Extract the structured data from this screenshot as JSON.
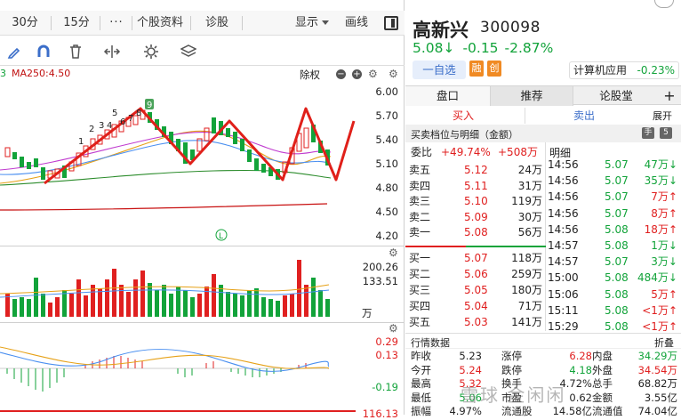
{
  "toolbar": {
    "tabs": [
      "30分",
      "15分",
      "个股资料",
      "诊股"
    ],
    "more": "···",
    "display": "显示",
    "draw": "画线"
  },
  "ma_line": {
    "index": "3",
    "ma250": "MA250:4.50",
    "adjust": "除权"
  },
  "axis": {
    "price": [
      "6.00",
      "5.70",
      "5.40",
      "5.10",
      "4.80",
      "4.50",
      "4.20"
    ],
    "volume": [
      "200.26",
      "133.51",
      "万"
    ],
    "macd": [
      "0.29",
      "0.13",
      "-0.19",
      "116.13"
    ]
  },
  "stock": {
    "name": "高新兴",
    "code": "300098",
    "price": "5.08↓",
    "change": "-0.15",
    "pct": "-2.87%"
  },
  "actions": {
    "watch": "一自选",
    "rong": "融",
    "chuang": "创"
  },
  "sector": {
    "name": "计算机应用",
    "pct": "-0.23%"
  },
  "tabs": [
    "盘口",
    "推荐",
    "论股堂",
    "+"
  ],
  "subtabs": {
    "buy": "买入",
    "sell": "卖出",
    "expand": "展开"
  },
  "section_title": "买卖档位与明细（金额）",
  "section_badges": [
    "手",
    "5"
  ],
  "weibi": {
    "label": "委比",
    "pct": "+49.74%",
    "amount": "+508万"
  },
  "detail_title": "明细",
  "asks": [
    {
      "label": "卖五",
      "price": "5.12",
      "vol": "24万"
    },
    {
      "label": "卖四",
      "price": "5.11",
      "vol": "31万"
    },
    {
      "label": "卖三",
      "price": "5.10",
      "vol": "119万"
    },
    {
      "label": "卖二",
      "price": "5.09",
      "vol": "30万"
    },
    {
      "label": "卖一",
      "price": "5.08",
      "vol": "56万"
    }
  ],
  "bids": [
    {
      "label": "买一",
      "price": "5.07",
      "vol": "118万"
    },
    {
      "label": "买二",
      "price": "5.06",
      "vol": "259万"
    },
    {
      "label": "买三",
      "price": "5.05",
      "vol": "180万"
    },
    {
      "label": "买四",
      "price": "5.04",
      "vol": "71万"
    },
    {
      "label": "买五",
      "price": "5.03",
      "vol": "141万"
    }
  ],
  "trades": [
    {
      "time": "14:56",
      "price": "5.07",
      "vol": "47万↓",
      "dir": "down"
    },
    {
      "time": "14:56",
      "price": "5.07",
      "vol": "35万↓",
      "dir": "down"
    },
    {
      "time": "14:56",
      "price": "5.07",
      "vol": "7万↑",
      "dir": "up"
    },
    {
      "time": "14:56",
      "price": "5.07",
      "vol": "8万↑",
      "dir": "up"
    },
    {
      "time": "14:56",
      "price": "5.08",
      "vol": "18万↑",
      "dir": "up"
    },
    {
      "time": "14:57",
      "price": "5.08",
      "vol": "1万↓",
      "dir": "down"
    },
    {
      "time": "14:57",
      "price": "5.07",
      "vol": "3万↓",
      "dir": "down"
    },
    {
      "time": "15:00",
      "price": "5.08",
      "vol": "484万↓",
      "dir": "down"
    },
    {
      "time": "15:06",
      "price": "5.08",
      "vol": "5万↑",
      "dir": "up"
    },
    {
      "time": "15:11",
      "price": "5.08",
      "vol": "<1万↑",
      "dir": "up"
    },
    {
      "time": "15:29",
      "price": "5.08",
      "vol": "<1万↑",
      "dir": "up"
    }
  ],
  "stats_title": "行情数据",
  "stats_fold": "折叠",
  "stats": [
    [
      {
        "k": "昨收",
        "v": "5.23",
        "c": "n"
      },
      {
        "k": "涨停",
        "v": "6.28",
        "c": "r"
      },
      {
        "k": "内盘",
        "v": "34.29万",
        "c": "g"
      }
    ],
    [
      {
        "k": "今开",
        "v": "5.24",
        "c": "r"
      },
      {
        "k": "跌停",
        "v": "4.18",
        "c": "g"
      },
      {
        "k": "外盘",
        "v": "34.54万",
        "c": "r"
      }
    ],
    [
      {
        "k": "最高",
        "v": "5.32",
        "c": "r"
      },
      {
        "k": "换手",
        "v": "4.72%",
        "c": "n"
      },
      {
        "k": "总手",
        "v": "68.82万",
        "c": "n"
      }
    ],
    [
      {
        "k": "最低",
        "v": "5.06",
        "c": "g"
      },
      {
        "k": "市盈",
        "v": "0.62",
        "c": "n"
      },
      {
        "k": "金额",
        "v": "3.55亿",
        "c": "n"
      }
    ],
    [
      {
        "k": "振幅",
        "v": "4.97%",
        "c": "n"
      },
      {
        "k": "流通股",
        "v": "14.58亿",
        "c": "n"
      },
      {
        "k": "流通值",
        "v": "74.04亿",
        "c": "n"
      }
    ]
  ],
  "watermark": "雪球 金闲闲",
  "colors": {
    "up": "#e02020",
    "down": "#12a33a",
    "accent": "#3b6ec9"
  }
}
